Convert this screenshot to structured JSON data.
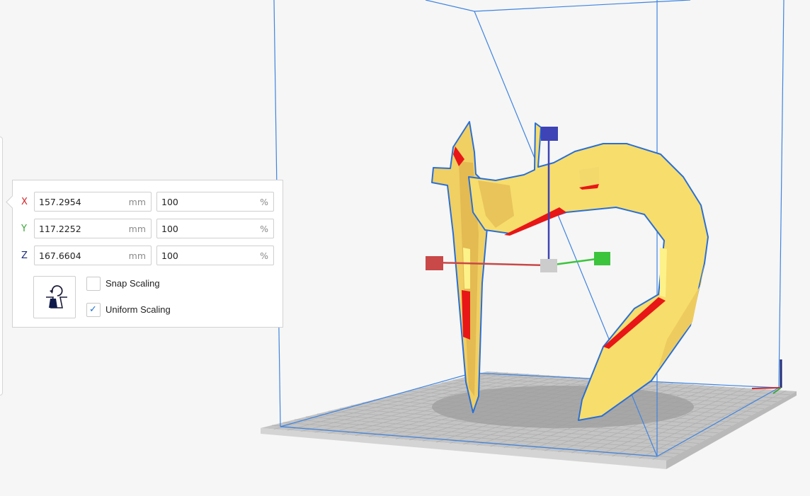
{
  "scale_panel": {
    "rows": [
      {
        "axis": "X",
        "axis_color": "#d0262a",
        "size_value": "157.2954",
        "size_unit": "mm",
        "percent_value": "100",
        "percent_unit": "%"
      },
      {
        "axis": "Y",
        "axis_color": "#3aa63a",
        "size_value": "117.2252",
        "size_unit": "mm",
        "percent_value": "100",
        "percent_unit": "%"
      },
      {
        "axis": "Z",
        "axis_color": "#1d2a7a",
        "size_value": "167.6604",
        "size_unit": "mm",
        "percent_value": "100",
        "percent_unit": "%"
      }
    ],
    "reset_icon": "reset-scale-icon",
    "snap_scaling": {
      "label": "Snap Scaling",
      "checked": false
    },
    "uniform_scaling": {
      "label": "Uniform Scaling",
      "checked": true
    }
  },
  "colors": {
    "background": "#f6f6f6",
    "build_volume_edge": "#3f84e0",
    "model_yellow": "#f7dd6c",
    "overhang_red": "#e81616",
    "handle_x": "#c94848",
    "handle_y": "#3cc43c",
    "handle_z": "#3e43b5",
    "handle_center": "#cccccc"
  }
}
